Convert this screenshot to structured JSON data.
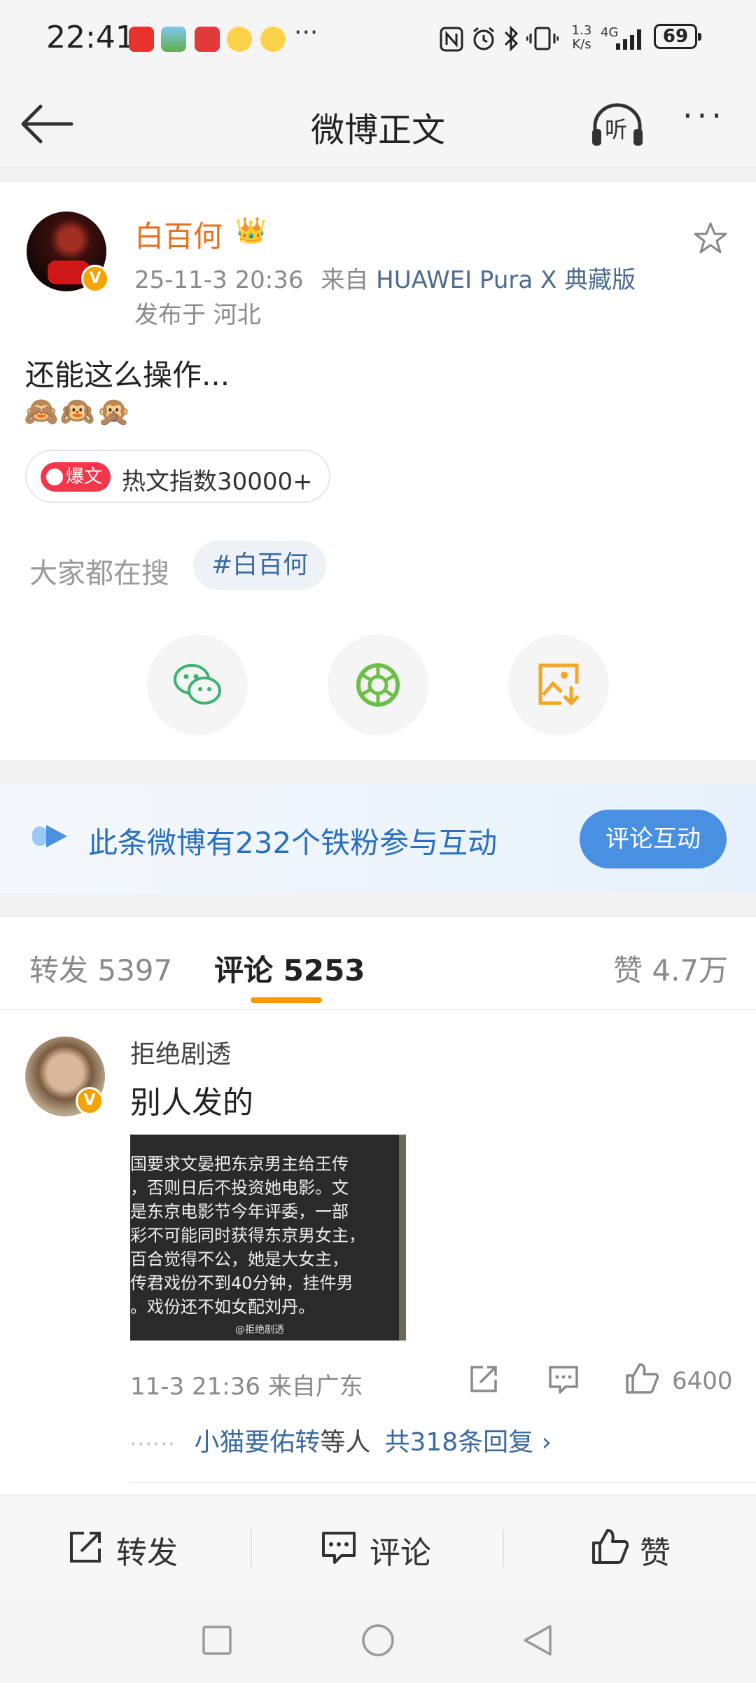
{
  "status_bar": {
    "time": "22:41",
    "more": "···",
    "speed_value": "1.3",
    "speed_unit": "K/s",
    "network": "4G",
    "battery": "69"
  },
  "nav": {
    "title": "微博正文",
    "listen_label": "听",
    "more": "···"
  },
  "post": {
    "author": "白百何",
    "date": "25-11-3 20:36",
    "from_prefix": "来自",
    "device": "HUAWEI Pura X 典藏版",
    "location": "发布于 河北",
    "text": "还能这么操作...",
    "emoji": "🙈🙉🙊",
    "hot_badge": "爆文",
    "hot_text": "热文指数30000+",
    "search_label": "大家都在搜",
    "search_tag": "#白百何"
  },
  "fans_banner": {
    "text": "此条微博有232个铁粉参与互动",
    "button": "评论互动"
  },
  "tabs": {
    "repost": "转发 5397",
    "comment": "评论 5253",
    "like": "赞 4.7万"
  },
  "comment": {
    "author": "拒绝剧透",
    "text": "别人发的",
    "image_lines": [
      "国要求文晏把东京男主给王传",
      "，否则日后不投资她电影。文",
      "是东京电影节今年评委，一部",
      "彩不可能同时获得东京男女主，",
      "百合觉得不公，她是大女主，",
      "传君戏份不到40分钟，挂件男",
      "。戏份还不如女配刘丹。"
    ],
    "image_watermark": "@拒绝剧透",
    "meta": "11-3 21:36 来自广东",
    "like_count": "6400",
    "replies_dots": "······",
    "replies_user": "小猫要佑转",
    "replies_mid": "等人",
    "replies_total": "共318条回复 ›"
  },
  "action_bar": {
    "repost": "转发",
    "comment": "评论",
    "like": "赞"
  },
  "colors": {
    "author_orange": "#e8701a",
    "link_blue": "#3a6aa0",
    "accent_blue": "#4a90e2",
    "tab_underline": "#f59b00",
    "verified_badge": "#f5a300"
  }
}
